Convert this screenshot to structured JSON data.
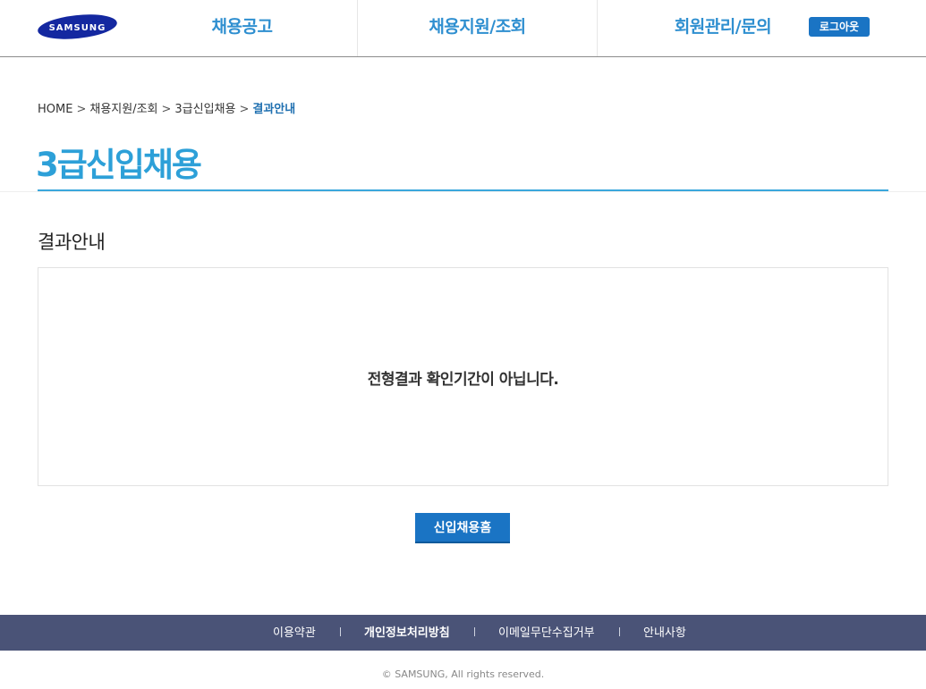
{
  "header": {
    "logo_text": "SAMSUNG",
    "nav": [
      {
        "label": "채용공고"
      },
      {
        "label": "채용지원/조회"
      },
      {
        "label": "회원관리/문의"
      }
    ],
    "logout_label": "로그아웃"
  },
  "breadcrumb": {
    "items": [
      "HOME",
      "채용지원/조회",
      "3급신입채용"
    ],
    "current": "결과안내",
    "separator": ">"
  },
  "page": {
    "title": "3급신입채용",
    "section_title": "결과안내",
    "message": "전형결과 확인기간이 아닙니다.",
    "home_button_label": "신입채용홈"
  },
  "footer": {
    "links": [
      {
        "label": "이용약관"
      },
      {
        "label": "개인정보처리방침"
      },
      {
        "label": "이메일무단수집거부"
      },
      {
        "label": "안내사항"
      }
    ],
    "divider": "l",
    "copyright": "© SAMSUNG, All rights reserved."
  },
  "colors": {
    "accent_blue": "#1a74c4",
    "title_blue": "#2da0d8",
    "footer_bg": "#4a5377",
    "samsung_blue": "#1428a0"
  }
}
